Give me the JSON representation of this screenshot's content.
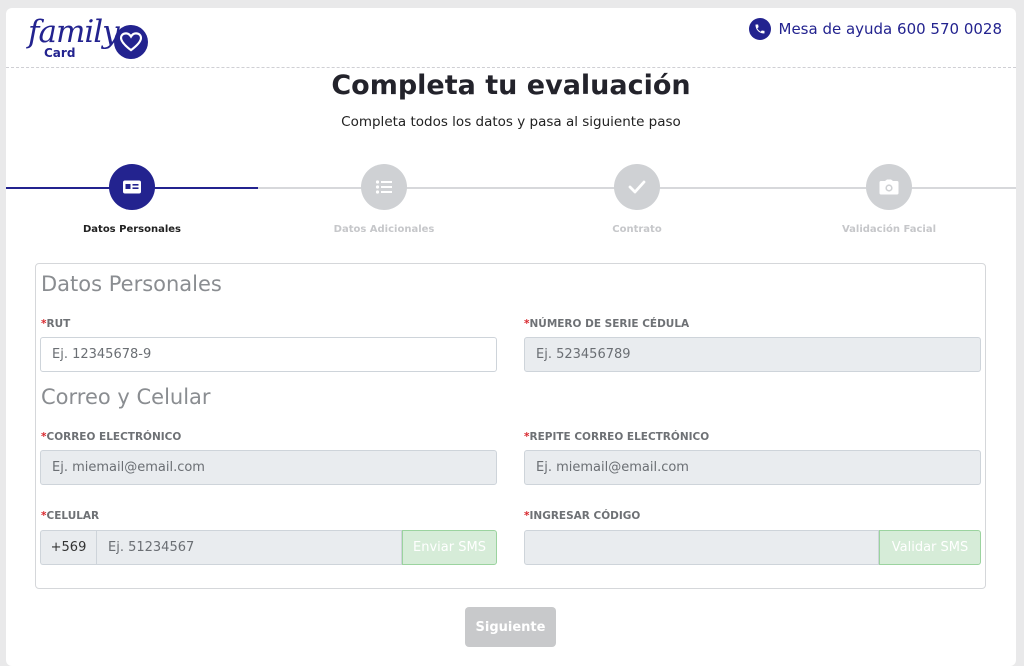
{
  "brand": {
    "logo_word": "family",
    "logo_sub": "Card",
    "primary_color": "#23238f"
  },
  "helpdesk": {
    "text": "Mesa de ayuda 600 570 0028",
    "icon": "phone-icon"
  },
  "page": {
    "title": "Completa tu evaluación",
    "subtitle": "Completa todos los datos y pasa al siguiente paso"
  },
  "steps": [
    {
      "label": "Datos Personales",
      "icon": "id-card-icon",
      "state": "active"
    },
    {
      "label": "Datos Adicionales",
      "icon": "list-icon",
      "state": "inactive"
    },
    {
      "label": "Contrato",
      "icon": "check-icon",
      "state": "inactive"
    },
    {
      "label": "Validación Facial",
      "icon": "camera-icon",
      "state": "inactive"
    }
  ],
  "form": {
    "section_personal": "Datos Personales",
    "section_contact": "Correo y Celular",
    "required_mark": "*",
    "rut": {
      "label": "RUT",
      "placeholder": "Ej. 12345678-9",
      "value": ""
    },
    "serie": {
      "label": "NÚMERO DE SERIE CÉDULA",
      "placeholder": "Ej. 523456789",
      "value": ""
    },
    "email": {
      "label": "CORREO ELECTRÓNICO",
      "placeholder": "Ej. miemail@email.com",
      "value": ""
    },
    "email_repeat": {
      "label": "REPITE CORREO ELECTRÓNICO",
      "placeholder": "Ej. miemail@email.com",
      "value": ""
    },
    "phone": {
      "label": "CELULAR",
      "prefix": "+569",
      "placeholder": "Ej. 51234567",
      "button": "Enviar SMS"
    },
    "code": {
      "label": "INGRESAR CÓDIGO",
      "placeholder": "",
      "button": "Validar SMS"
    }
  },
  "actions": {
    "next": "Siguiente"
  }
}
